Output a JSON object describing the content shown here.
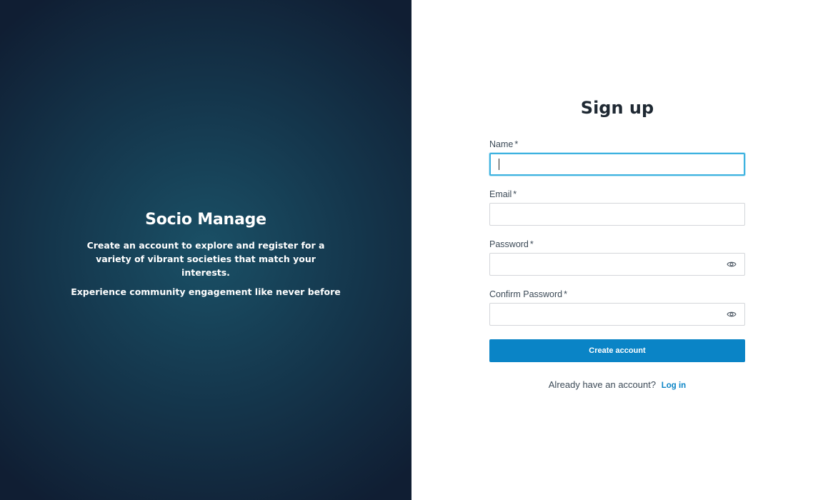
{
  "hero": {
    "title": "Socio Manage",
    "description": "Create an account to explore and register for a variety of vibrant societies that match your interests.",
    "tagline": "Experience community engagement like never before"
  },
  "form": {
    "title": "Sign up",
    "required_marker": "*",
    "fields": {
      "name": {
        "label": "Name",
        "value": "",
        "placeholder": ""
      },
      "email": {
        "label": "Email",
        "value": "",
        "placeholder": ""
      },
      "password": {
        "label": "Password",
        "value": "",
        "placeholder": "",
        "icon": "eye-icon"
      },
      "confirm_password": {
        "label": "Confirm Password",
        "value": "",
        "placeholder": "",
        "icon": "eye-icon"
      }
    },
    "submit_label": "Create account",
    "login_prompt": "Already have an account?",
    "login_link": "Log in"
  },
  "colors": {
    "primary": "#0a84c6",
    "focus_border": "#3db2e0",
    "hero_dark": "#101e33",
    "hero_light": "#1a5066",
    "title_text": "#1f2933"
  }
}
